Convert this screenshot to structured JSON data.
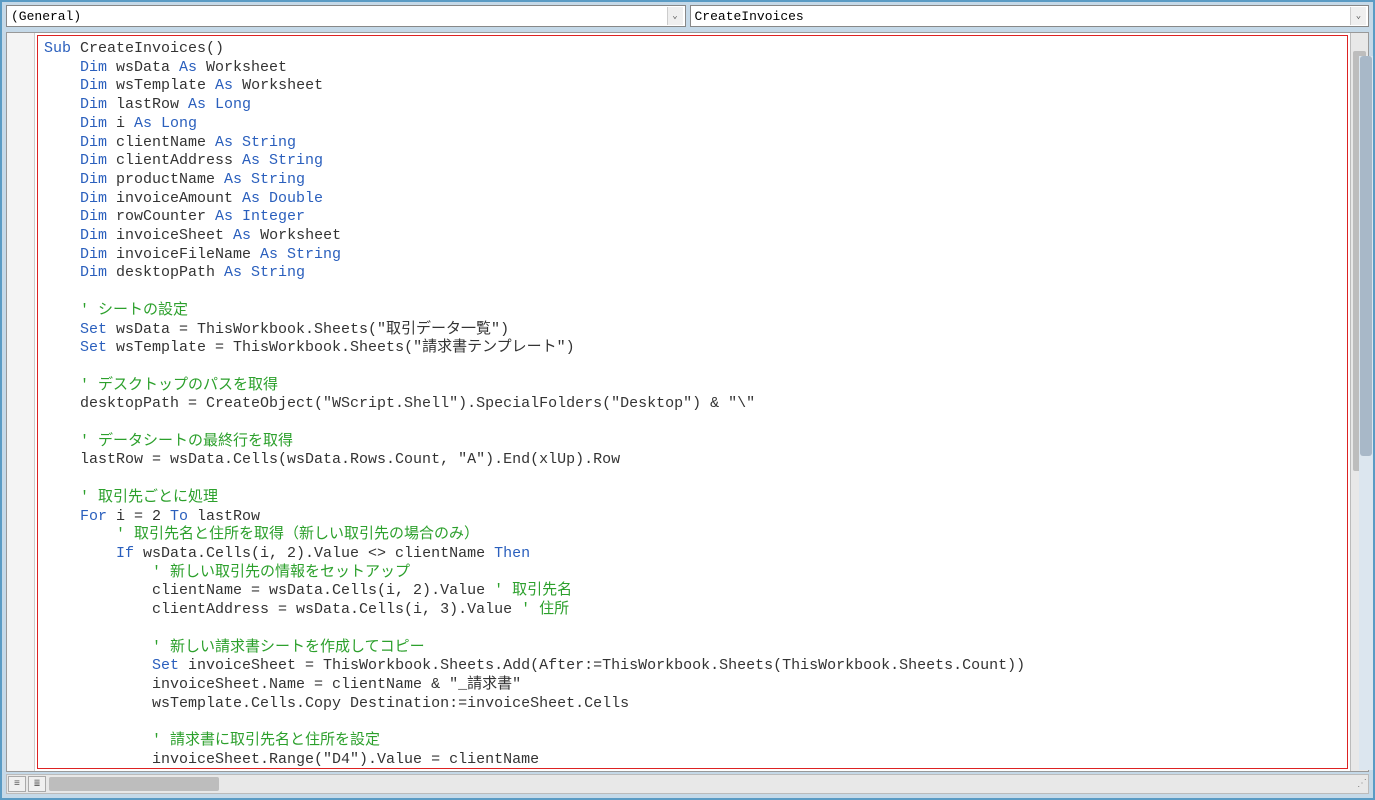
{
  "dropdowns": {
    "object": "(General)",
    "procedure": "CreateInvoices"
  },
  "code": {
    "l01a": "Sub",
    "l01b": " CreateInvoices()",
    "l02a": "    Dim",
    "l02b": " wsData ",
    "l02c": "As",
    "l02d": " Worksheet",
    "l03a": "    Dim",
    "l03b": " wsTemplate ",
    "l03c": "As",
    "l03d": " Worksheet",
    "l04a": "    Dim",
    "l04b": " lastRow ",
    "l04c": "As Long",
    "l05a": "    Dim",
    "l05b": " i ",
    "l05c": "As Long",
    "l06a": "    Dim",
    "l06b": " clientName ",
    "l06c": "As String",
    "l07a": "    Dim",
    "l07b": " clientAddress ",
    "l07c": "As String",
    "l08a": "    Dim",
    "l08b": " productName ",
    "l08c": "As String",
    "l09a": "    Dim",
    "l09b": " invoiceAmount ",
    "l09c": "As Double",
    "l10a": "    Dim",
    "l10b": " rowCounter ",
    "l10c": "As Integer",
    "l11a": "    Dim",
    "l11b": " invoiceSheet ",
    "l11c": "As",
    "l11d": " Worksheet",
    "l12a": "    Dim",
    "l12b": " invoiceFileName ",
    "l12c": "As String",
    "l13a": "    Dim",
    "l13b": " desktopPath ",
    "l13c": "As String",
    "blank": "",
    "l15": "    ' シートの設定",
    "l16a": "    Set",
    "l16b": " wsData = ThisWorkbook.Sheets(\"取引データ一覧\")",
    "l17a": "    Set",
    "l17b": " wsTemplate = ThisWorkbook.Sheets(\"請求書テンプレート\")",
    "l19": "    ' デスクトップのパスを取得",
    "l20": "    desktopPath = CreateObject(\"WScript.Shell\").SpecialFolders(\"Desktop\") & \"\\\"",
    "l22": "    ' データシートの最終行を取得",
    "l23": "    lastRow = wsData.Cells(wsData.Rows.Count, \"A\").End(xlUp).Row",
    "l25": "    ' 取引先ごとに処理",
    "l26a": "    For",
    "l26b": " i = 2 ",
    "l26c": "To",
    "l26d": " lastRow",
    "l27": "        ' 取引先名と住所を取得（新しい取引先の場合のみ）",
    "l28a": "        If",
    "l28b": " wsData.Cells(i, 2).Value <> clientName ",
    "l28c": "Then",
    "l29": "            ' 新しい取引先の情報をセットアップ",
    "l30a": "            clientName = wsData.Cells(i, 2).Value ",
    "l30b": "' 取引先名",
    "l31a": "            clientAddress = wsData.Cells(i, 3).Value ",
    "l31b": "' 住所",
    "l33": "            ' 新しい請求書シートを作成してコピー",
    "l34a": "            Set",
    "l34b": " invoiceSheet = ThisWorkbook.Sheets.Add(After:=ThisWorkbook.Sheets(ThisWorkbook.Sheets.Count))",
    "l35": "            invoiceSheet.Name = clientName & \"_請求書\"",
    "l36": "            wsTemplate.Cells.Copy Destination:=invoiceSheet.Cells",
    "l38": "            ' 請求書に取引先名と住所を設定",
    "l39": "            invoiceSheet.Range(\"D4\").Value = clientName"
  }
}
